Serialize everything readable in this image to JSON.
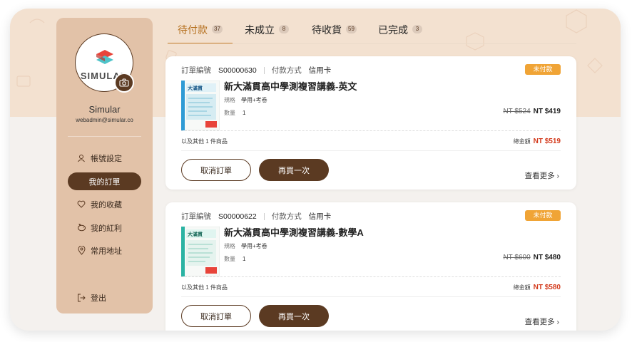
{
  "sidebar": {
    "logo_text": "SIMULAR",
    "user_name": "Simular",
    "user_email": "webadmin@simular.co",
    "items": [
      {
        "label": "帳號設定",
        "icon": "user-icon"
      },
      {
        "label": "我的訂單",
        "icon": "",
        "active": true
      },
      {
        "label": "我的收藏",
        "icon": "heart-icon"
      },
      {
        "label": "我的紅利",
        "icon": "piggy-bank-icon"
      },
      {
        "label": "常用地址",
        "icon": "location-pin-icon"
      },
      {
        "label": "登出",
        "icon": "logout-icon"
      }
    ]
  },
  "tabs": [
    {
      "label": "待付款",
      "count": "37",
      "active": true
    },
    {
      "label": "未成立",
      "count": "8"
    },
    {
      "label": "待收貨",
      "count": "59"
    },
    {
      "label": "已完成",
      "count": "3"
    }
  ],
  "orders": [
    {
      "order_no_label": "訂單編號",
      "order_no": "S00000630",
      "pay_label": "付款方式",
      "pay_method": "信用卡",
      "status": "未付款",
      "title": "新大滿貫高中學測複習講義-英文",
      "spec_label": "規格",
      "spec": "學用+考卷",
      "qty_label": "數量",
      "qty": "1",
      "old_price": "NT $524",
      "price": "NT $419",
      "others": "以及其他 1 件商品",
      "total_label": "總金額",
      "total": "NT $519",
      "cancel_label": "取消訂單",
      "rebuy_label": "再買一次",
      "more_label": "查看更多 ›"
    },
    {
      "order_no_label": "訂單編號",
      "order_no": "S00000622",
      "pay_label": "付款方式",
      "pay_method": "信用卡",
      "status": "未付款",
      "title": "新大滿貫高中學測複習講義-數學A",
      "spec_label": "規格",
      "spec": "學用+考卷",
      "qty_label": "數量",
      "qty": "1",
      "old_price": "NT $600",
      "price": "NT $480",
      "others": "以及其他 1 件商品",
      "total_label": "總金額",
      "total": "NT $580",
      "cancel_label": "取消訂單",
      "rebuy_label": "再買一次",
      "more_label": "查看更多 ›"
    }
  ],
  "colors": {
    "brand_brown": "#5b3a22",
    "accent_orange": "#c9802c",
    "status_orange": "#f0a436",
    "total_red": "#d33a1c",
    "sidebar_bg": "#e2c2a8",
    "hero_bg": "#f3e1d0"
  }
}
